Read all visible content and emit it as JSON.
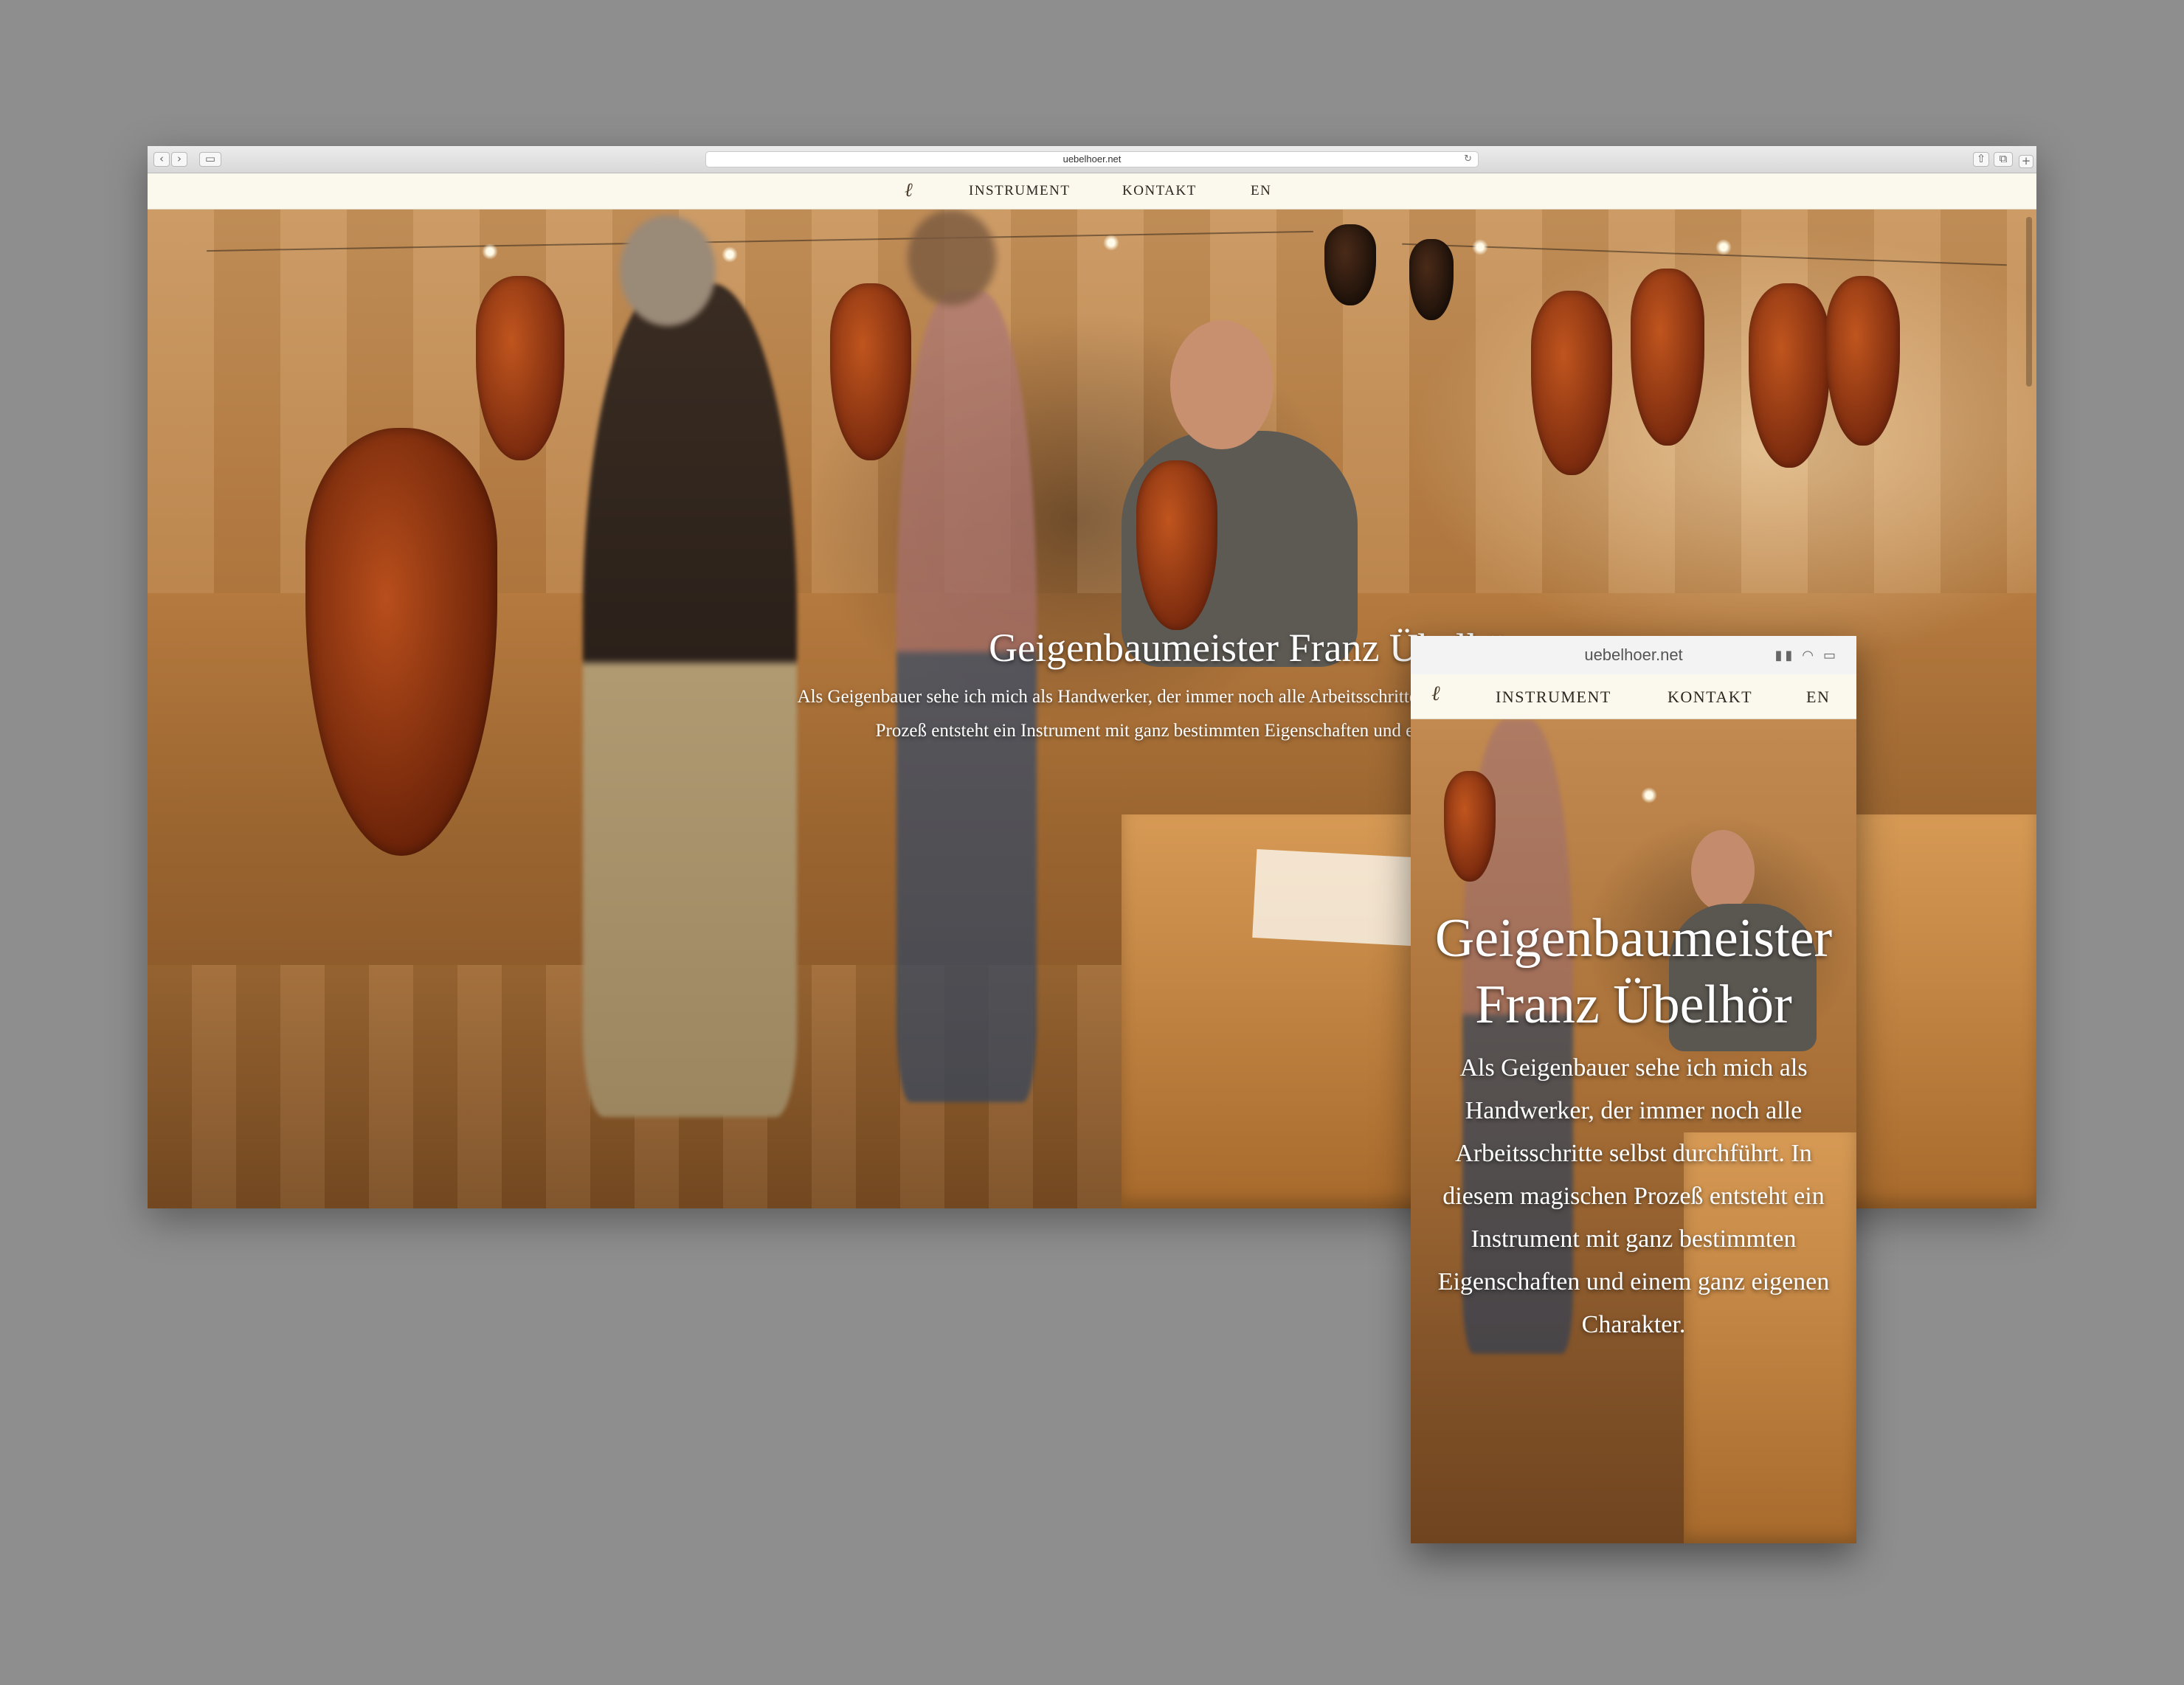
{
  "browser": {
    "url": "uebelhoer.net"
  },
  "site": {
    "logo": "ℓ",
    "nav": [
      {
        "label": "INSTRUMENT"
      },
      {
        "label": "KONTAKT"
      },
      {
        "label": "EN"
      }
    ],
    "hero": {
      "title": "Geigenbaumeister Franz Übelhör",
      "intro": "Als Geigenbauer sehe ich mich als Handwerker, der immer noch alle Arbeitsschritte selbst durchführt. In diesem magischen Prozeß entsteht ein Instrument mit ganz bestimmten Eigenschaften und einem ganz eigenen Charakter."
    }
  },
  "mobile": {
    "url": "uebelhoer.net",
    "title_line1": "Geigenbaumeister",
    "title_line2": "Franz Übelhör"
  },
  "colors": {
    "background": "#8e8e8e",
    "nav_bg": "#fbf8ee",
    "hero_text": "#ffffff"
  }
}
